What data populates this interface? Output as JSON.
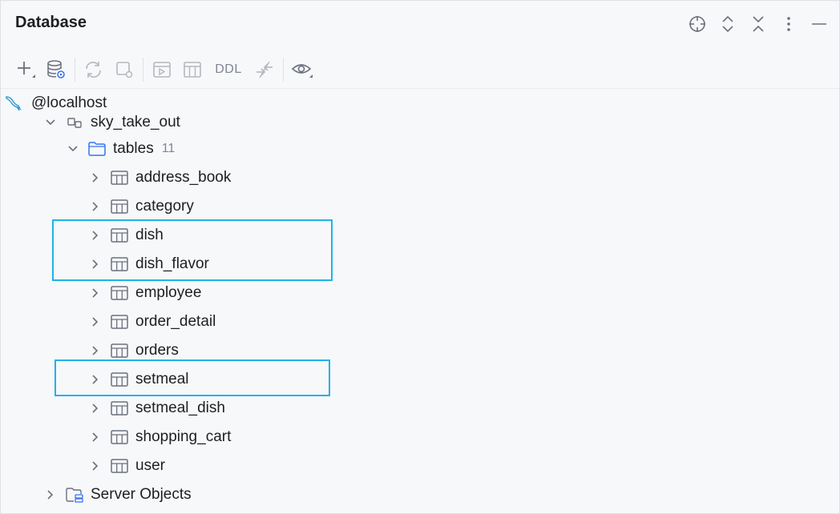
{
  "header": {
    "title": "Database"
  },
  "toolbar": {
    "ddl_label": "DDL"
  },
  "tree": {
    "connection": "@localhost",
    "schema": "sky_take_out",
    "folder": {
      "label": "tables",
      "count": "11"
    },
    "tables": [
      "address_book",
      "category",
      "dish",
      "dish_flavor",
      "employee",
      "order_detail",
      "orders",
      "setmeal",
      "setmeal_dish",
      "shopping_cart",
      "user"
    ],
    "server_objects": "Server Objects"
  },
  "highlights": {
    "color": "#1fb2e8"
  }
}
